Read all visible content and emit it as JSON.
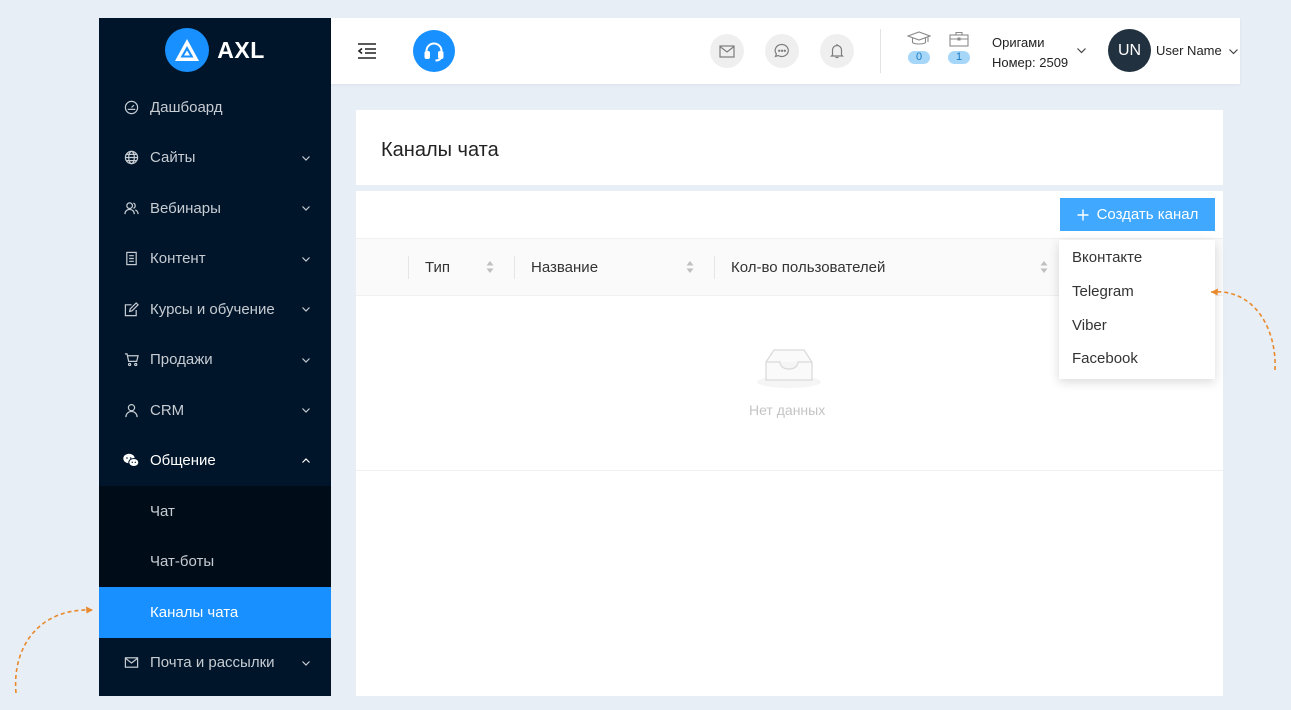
{
  "logo": {
    "text": "AXL",
    "brand_color": "#1890ff"
  },
  "sidebar": {
    "items": [
      {
        "label": "Дашбоард",
        "icon": "dashboard-icon",
        "has_children": false
      },
      {
        "label": "Сайты",
        "icon": "globe-icon",
        "has_children": true
      },
      {
        "label": "Вебинары",
        "icon": "users-icon",
        "has_children": true
      },
      {
        "label": "Контент",
        "icon": "book-icon",
        "has_children": true
      },
      {
        "label": "Курсы и обучение",
        "icon": "edit-icon",
        "has_children": true
      },
      {
        "label": "Продажи",
        "icon": "cart-icon",
        "has_children": true
      },
      {
        "label": "CRM",
        "icon": "user-icon",
        "has_children": true
      },
      {
        "label": "Общение",
        "icon": "wechat-icon",
        "has_children": true,
        "open": true
      },
      {
        "label": "Почта и рассылки",
        "icon": "mail-icon",
        "has_children": true
      }
    ],
    "submenu": [
      {
        "label": "Чат",
        "active": false
      },
      {
        "label": "Чат-боты",
        "active": false
      },
      {
        "label": "Каналы чата",
        "active": true
      }
    ]
  },
  "header": {
    "stats": [
      {
        "icon": "graduation-cap-icon",
        "count": "0"
      },
      {
        "icon": "briefcase-icon",
        "count": "1"
      }
    ],
    "org_name": "Оригами",
    "org_number": "Номер: 2509",
    "avatar_initials": "UN",
    "user_name": "User Name"
  },
  "page": {
    "title": "Каналы чата",
    "create_button": "Создать канал",
    "columns": [
      "Тип",
      "Название",
      "Кол-во пользователей"
    ],
    "empty_text": "Нет данных"
  },
  "dropdown": {
    "items": [
      "Вконтакте",
      "Telegram",
      "Viber",
      "Facebook"
    ]
  },
  "colors": {
    "sidebar_bg": "#001529",
    "accent": "#1890ff",
    "annotation": "#e8892c"
  }
}
